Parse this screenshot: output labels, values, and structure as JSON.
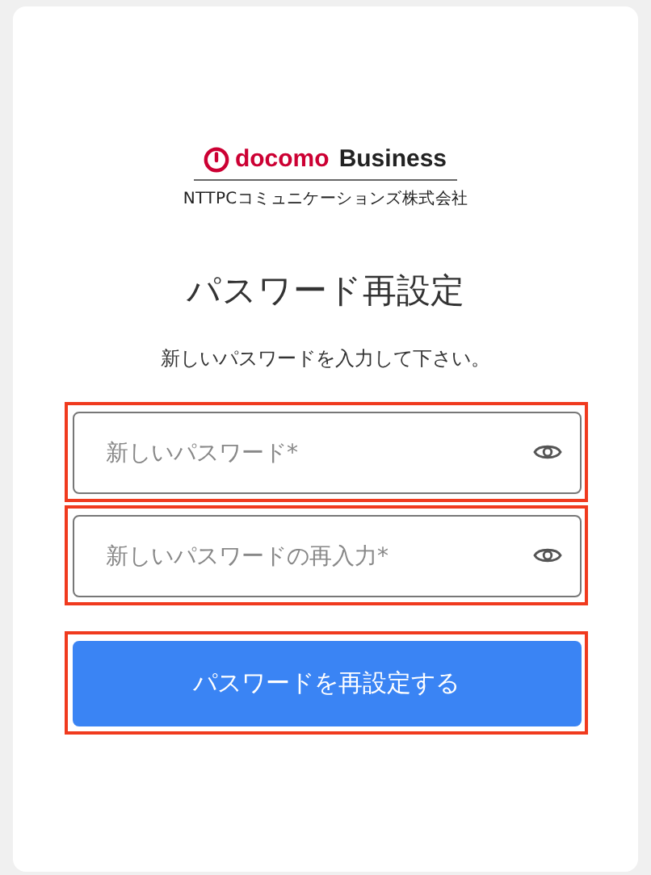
{
  "logo": {
    "brand": "docomo",
    "product": "Business",
    "company": "NTTPCコミュニケーションズ株式会社"
  },
  "title": "パスワード再設定",
  "description": "新しいパスワードを入力して下さい。",
  "fields": [
    {
      "placeholder": "新しいパスワード*",
      "highlighted": true
    },
    {
      "placeholder": "新しいパスワードの再入力*",
      "highlighted": true
    }
  ],
  "submit": {
    "label": "パスワードを再設定する",
    "highlighted": true
  }
}
